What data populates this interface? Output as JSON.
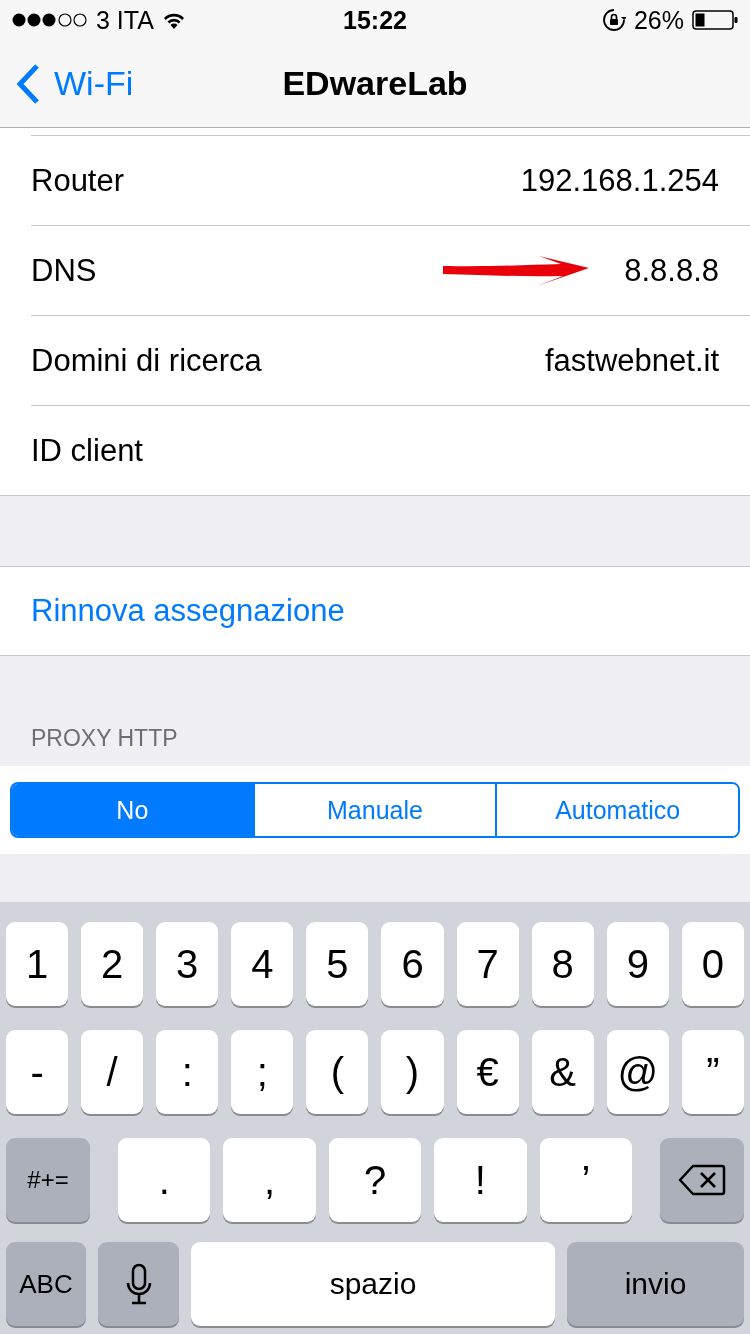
{
  "status_bar": {
    "carrier": "3 ITA",
    "time": "15:22",
    "battery": "26%"
  },
  "nav": {
    "back": "Wi-Fi",
    "title": "EDwareLab"
  },
  "rows": [
    {
      "label": "Router",
      "value": "192.168.1.254"
    },
    {
      "label": "DNS",
      "value": "8.8.8.8",
      "arrow_annotation": true
    },
    {
      "label": "Domini di ricerca",
      "value": "fastwebnet.it"
    },
    {
      "label": "ID client"
    }
  ],
  "action": "Rinnova assegnazione",
  "proxy": {
    "header": "PROXY HTTP",
    "segments": [
      {
        "label": "No",
        "selected": true
      },
      {
        "label": "Manuale",
        "selected": false
      },
      {
        "label": "Automatico",
        "selected": false
      }
    ]
  },
  "keyboard": [
    [
      {
        "kind": "char",
        "label": "1"
      },
      {
        "kind": "char",
        "label": "2"
      },
      {
        "kind": "char",
        "label": "3"
      },
      {
        "kind": "char",
        "label": "4"
      },
      {
        "kind": "char",
        "label": "5"
      },
      {
        "kind": "char",
        "label": "6"
      },
      {
        "kind": "char",
        "label": "7"
      },
      {
        "kind": "char",
        "label": "8"
      },
      {
        "kind": "char",
        "label": "9"
      },
      {
        "kind": "char",
        "label": "0"
      }
    ],
    [
      {
        "kind": "char",
        "label": "-"
      },
      {
        "kind": "char",
        "label": "/"
      },
      {
        "kind": "char",
        "label": ":"
      },
      {
        "kind": "char",
        "label": ";"
      },
      {
        "kind": "char",
        "label": "("
      },
      {
        "kind": "char",
        "label": ")"
      },
      {
        "kind": "char",
        "label": "€"
      },
      {
        "kind": "char",
        "label": "&"
      },
      {
        "kind": "char",
        "label": "@"
      },
      {
        "kind": "char",
        "label": "”"
      }
    ],
    [
      {
        "kind": "function",
        "label": "#+="
      },
      {
        "kind": "wide",
        "label": "."
      },
      {
        "kind": "wide",
        "label": ","
      },
      {
        "kind": "wide",
        "label": "?"
      },
      {
        "kind": "wide",
        "label": "!"
      },
      {
        "kind": "wide",
        "label": "’"
      },
      {
        "kind": "delete"
      }
    ],
    [
      {
        "kind": "function",
        "label": "ABC"
      },
      {
        "kind": "mic"
      },
      {
        "kind": "space",
        "label": "spazio"
      },
      {
        "kind": "return",
        "label": "invio"
      }
    ]
  ]
}
